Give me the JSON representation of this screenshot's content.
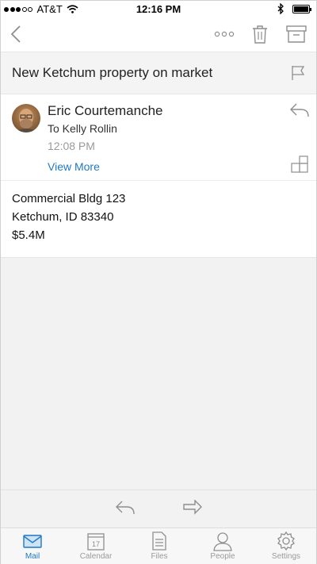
{
  "status_bar": {
    "carrier": "AT&T",
    "time": "12:16 PM",
    "signal_bars_filled": 3,
    "signal_bars_total": 5
  },
  "toolbar": {
    "back_icon": "chevron-left-icon",
    "more_icon": "more-dots-icon",
    "trash_icon": "trash-icon",
    "archive_icon": "archive-icon"
  },
  "subject": {
    "text": "New Ketchum property on market",
    "flag_icon": "flag-icon"
  },
  "message": {
    "sender": "Eric Courtemanche",
    "to": "To Kelly Rollin",
    "time": "12:08 PM",
    "view_more": "View More",
    "body_lines": [
      "Commercial Bldg 123",
      "Ketchum, ID 83340",
      "$5.4M"
    ]
  },
  "actions": {
    "reply_icon": "reply-icon",
    "forward_icon": "forward-icon"
  },
  "tabs": [
    {
      "label": "Mail",
      "icon": "mail-icon"
    },
    {
      "label": "Calendar",
      "icon": "calendar-icon",
      "day": "17"
    },
    {
      "label": "Files",
      "icon": "files-icon"
    },
    {
      "label": "People",
      "icon": "people-icon"
    },
    {
      "label": "Settings",
      "icon": "settings-icon"
    }
  ],
  "colors": {
    "accent": "#1f79c6",
    "icon_grey": "#8e8e8e",
    "subject_bg": "#f4f4f4",
    "empty_area_bg": "#f2f2f2"
  }
}
